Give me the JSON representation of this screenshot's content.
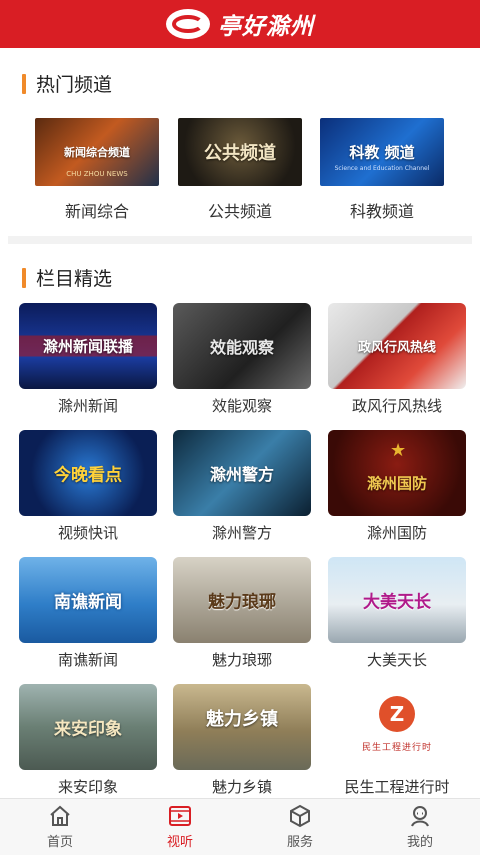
{
  "header": {
    "title": "亭好滁州",
    "brand_color": "#d91e24"
  },
  "hot_channels": {
    "title": "热门频道",
    "items": [
      {
        "label": "新闻综合",
        "thumb_text": "新闻综合频道",
        "thumb_sub": "CHU ZHOU NEWS"
      },
      {
        "label": "公共频道",
        "thumb_text": "公共频道"
      },
      {
        "label": "科教频道",
        "thumb_text": "科教 频道",
        "thumb_sub": "Science and Education Channel"
      }
    ]
  },
  "programs": {
    "title": "栏目精选",
    "items": [
      {
        "label": "滁州新闻",
        "thumb_text": "滁州新闻联播"
      },
      {
        "label": "效能观察",
        "thumb_text": "效能观察"
      },
      {
        "label": "政风行风热线",
        "thumb_text": "政风行风热线"
      },
      {
        "label": "视频快讯",
        "thumb_text": "今晚看点"
      },
      {
        "label": "滁州警方",
        "thumb_text": "滁州警方"
      },
      {
        "label": "滁州国防",
        "thumb_text": "滁州国防"
      },
      {
        "label": "南谯新闻",
        "thumb_text": "南谯新闻"
      },
      {
        "label": "魅力琅琊",
        "thumb_text": "魅力琅琊"
      },
      {
        "label": "大美天长",
        "thumb_text": "大美天长"
      },
      {
        "label": "来安印象",
        "thumb_text": "来安印象"
      },
      {
        "label": "魅力乡镇",
        "thumb_text": "魅力乡镇"
      },
      {
        "label": "民生工程进行时",
        "thumb_text": "民生工程进行时"
      }
    ]
  },
  "tabbar": {
    "items": [
      {
        "label": "首页",
        "icon": "home-icon"
      },
      {
        "label": "视听",
        "icon": "video-icon",
        "active": true
      },
      {
        "label": "服务",
        "icon": "box-icon"
      },
      {
        "label": "我的",
        "icon": "user-icon"
      }
    ]
  }
}
